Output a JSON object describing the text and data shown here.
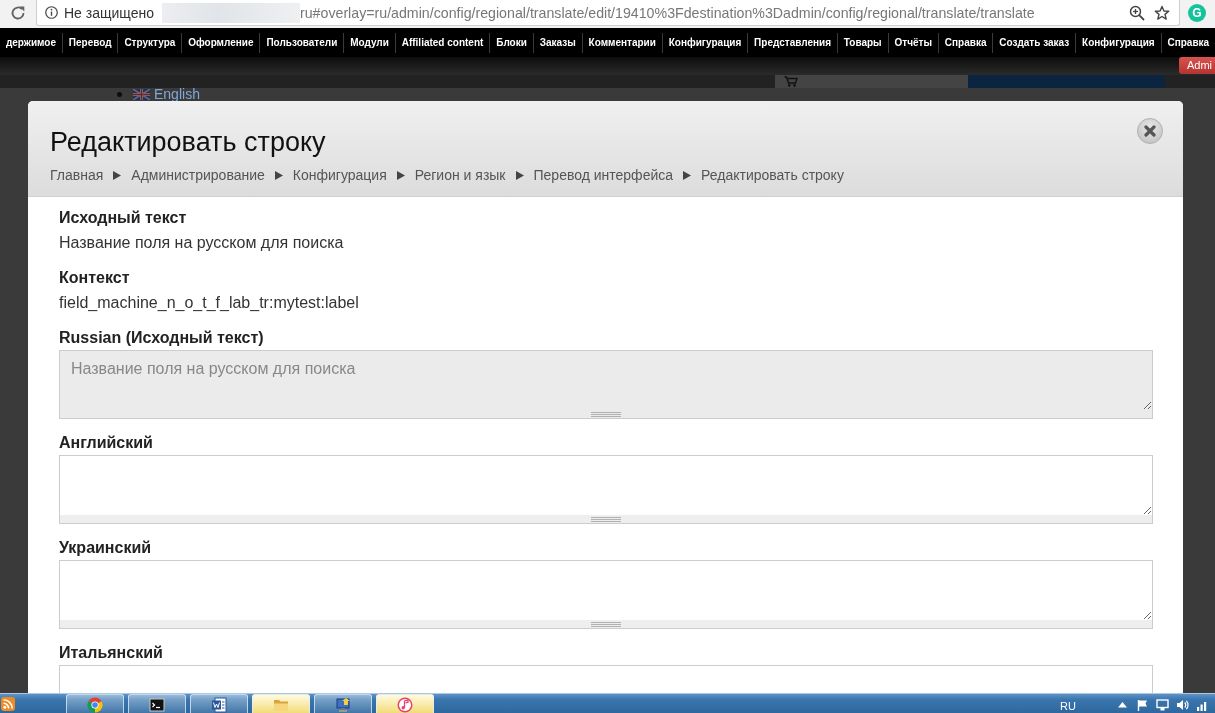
{
  "browser": {
    "security_label": "Не защищено",
    "url": "ru#overlay=ru/admin/config/regional/translate/edit/19410%3Fdestination%3Dadmin/config/regional/translate/translate",
    "extension_letter": "G"
  },
  "admin_menu": [
    "держимое",
    "Перевод",
    "Структура",
    "Оформление",
    "Пользователи",
    "Модули",
    "Affiliated content",
    "Блоки",
    "Заказы",
    "Комментарии",
    "Конфигурация",
    "Представления",
    "Товары",
    "Отчёты",
    "Справка",
    "Создать заказ",
    "Конфигурация",
    "Справка"
  ],
  "user_button": "Admi",
  "background_page": {
    "language_link": "English"
  },
  "dialog": {
    "title": "Редактировать строку",
    "breadcrumb": [
      "Главная",
      "Администрирование",
      "Конфигурация",
      "Регион и язык",
      "Перевод интерфейса",
      "Редактировать строку"
    ],
    "fields": [
      {
        "kind": "text",
        "label": "Исходный текст",
        "value": "Название поля на русском для поиска"
      },
      {
        "kind": "text",
        "label": "Контекст",
        "value": "field_machine_n_o_t_f_lab_tr:mytest:label"
      },
      {
        "kind": "textarea",
        "label": "Russian (Исходный текст)",
        "value": "Название поля на русском для поиска",
        "disabled": true
      },
      {
        "kind": "textarea",
        "label": "Английский",
        "disabled": false
      },
      {
        "kind": "textarea",
        "label": "Украинский",
        "disabled": false
      },
      {
        "kind": "textarea",
        "label": "Итальянский",
        "disabled": false
      }
    ]
  },
  "taskbar": {
    "apps": [
      {
        "kind": "chrome",
        "highlighted": false
      },
      {
        "kind": "terminal",
        "highlighted": false
      },
      {
        "kind": "word",
        "highlighted": false
      },
      {
        "kind": "folder",
        "highlighted": true
      },
      {
        "kind": "installer",
        "highlighted": false
      },
      {
        "kind": "music",
        "highlighted": true
      }
    ],
    "language": "RU"
  }
}
